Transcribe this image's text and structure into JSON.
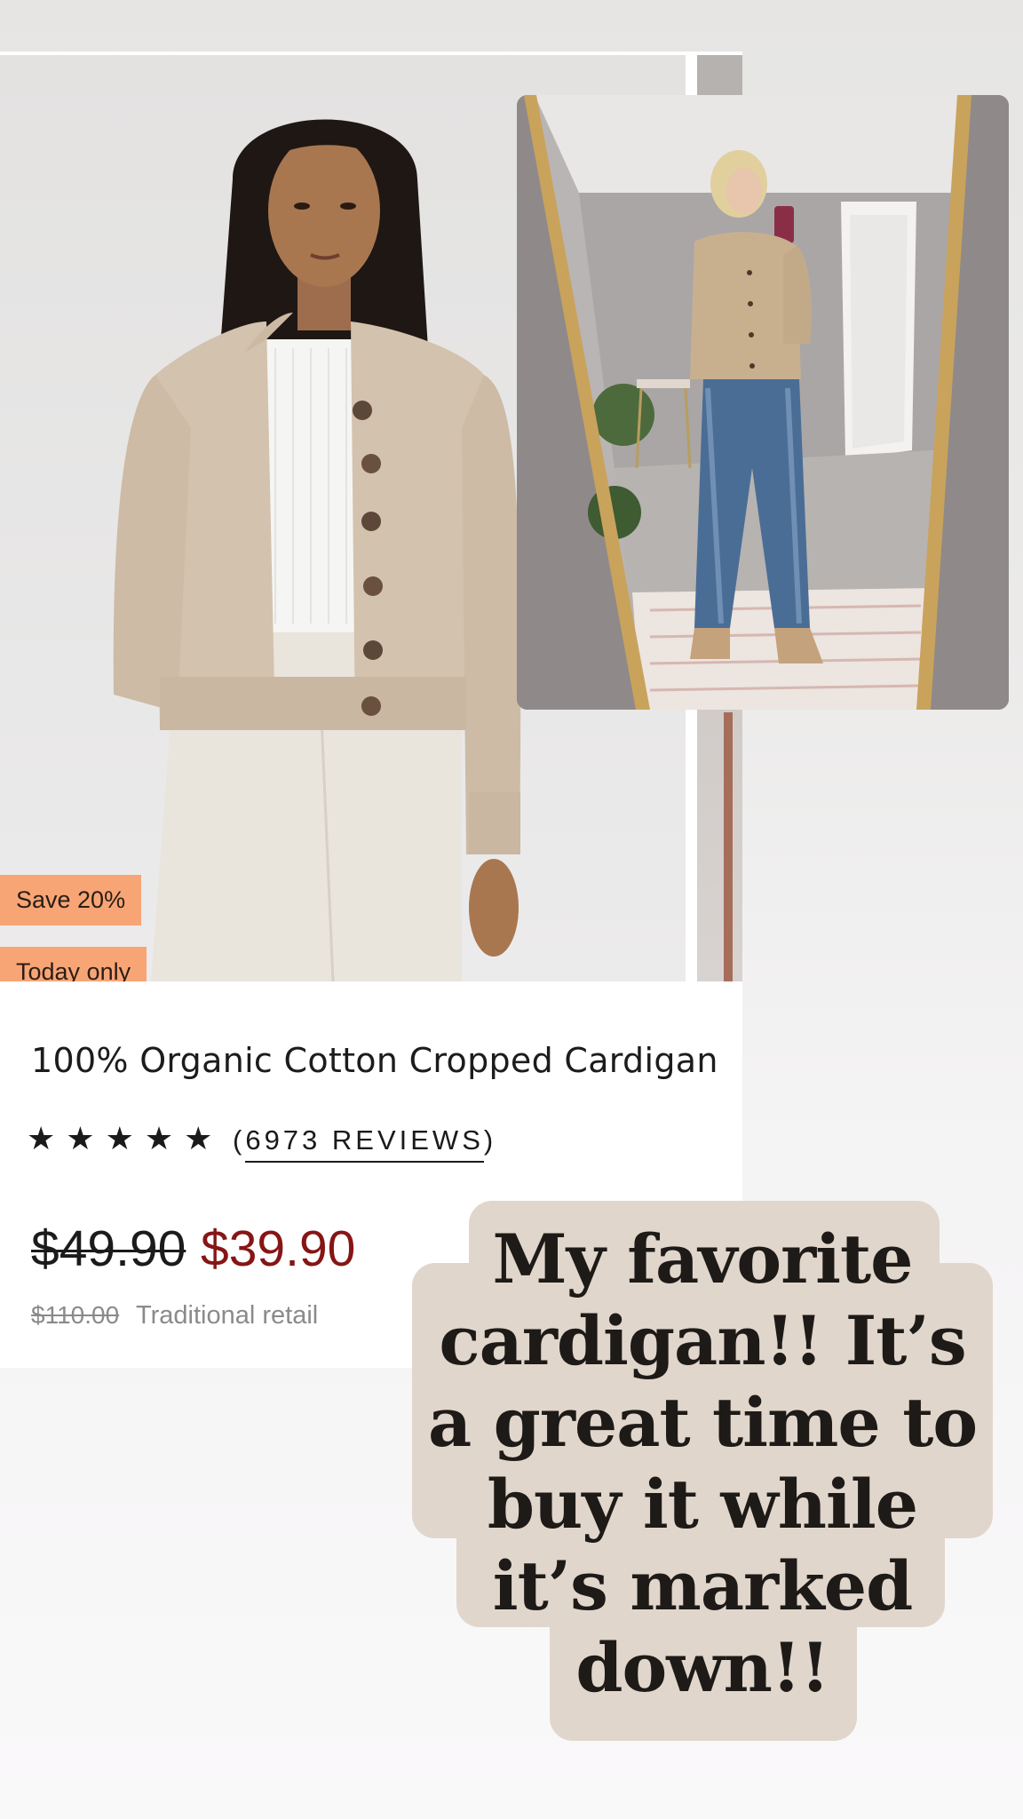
{
  "product": {
    "badges": {
      "save": "Save 20%",
      "today": "Today only"
    },
    "title": "100% Organic Cotton Cropped Cardigan",
    "rating": {
      "stars": 5,
      "reviews_open": "(",
      "reviews_label": "6973 REVIEWS",
      "reviews_close": ")"
    },
    "price": {
      "original": "$49.90",
      "sale": "$39.90",
      "retail": "$110.00",
      "retail_label": "Traditional retail"
    }
  },
  "overlay_text": {
    "lines": [
      "My favorite",
      "cardigan!! It’s",
      "a great time to",
      "buy it while",
      "it’s marked",
      "down!!"
    ]
  },
  "colors": {
    "badge": "#f8a576",
    "sale_price": "#861515",
    "bubble": "#e1d6cc"
  },
  "icons": {
    "rating": "star-icon"
  }
}
